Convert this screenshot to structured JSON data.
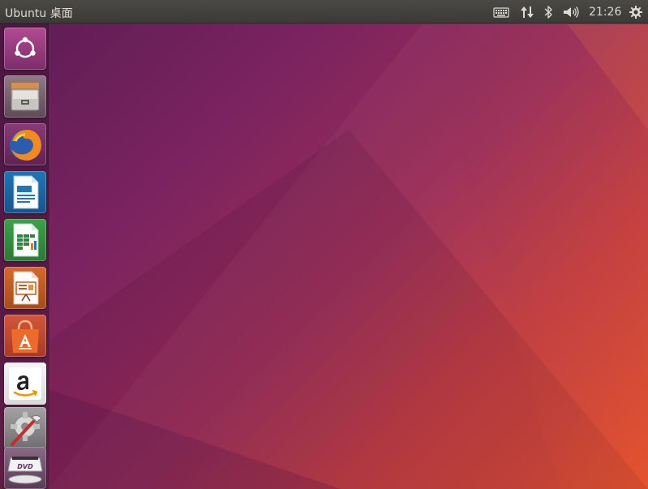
{
  "top_panel": {
    "title": "Ubuntu 桌面",
    "clock": "21:26",
    "indicators": [
      "keyboard-icon",
      "network-icon",
      "bluetooth-icon",
      "volume-icon",
      "power-gear-icon"
    ]
  },
  "launcher": {
    "items": [
      {
        "icon": "ubuntu-dash-icon"
      },
      {
        "icon": "files-icon"
      },
      {
        "icon": "firefox-icon"
      },
      {
        "icon": "libreoffice-writer-icon"
      },
      {
        "icon": "libreoffice-calc-icon"
      },
      {
        "icon": "libreoffice-impress-icon"
      },
      {
        "icon": "software-center-icon"
      },
      {
        "icon": "amazon-icon"
      },
      {
        "icon": "system-settings-icon"
      },
      {
        "icon": "dvd-drive-icon"
      }
    ]
  },
  "colors": {
    "panel_bg": "#3c3b37",
    "panel_text": "#dfdbd2",
    "wallpaper_start": "#5a1c52",
    "wallpaper_end": "#de4b28"
  }
}
